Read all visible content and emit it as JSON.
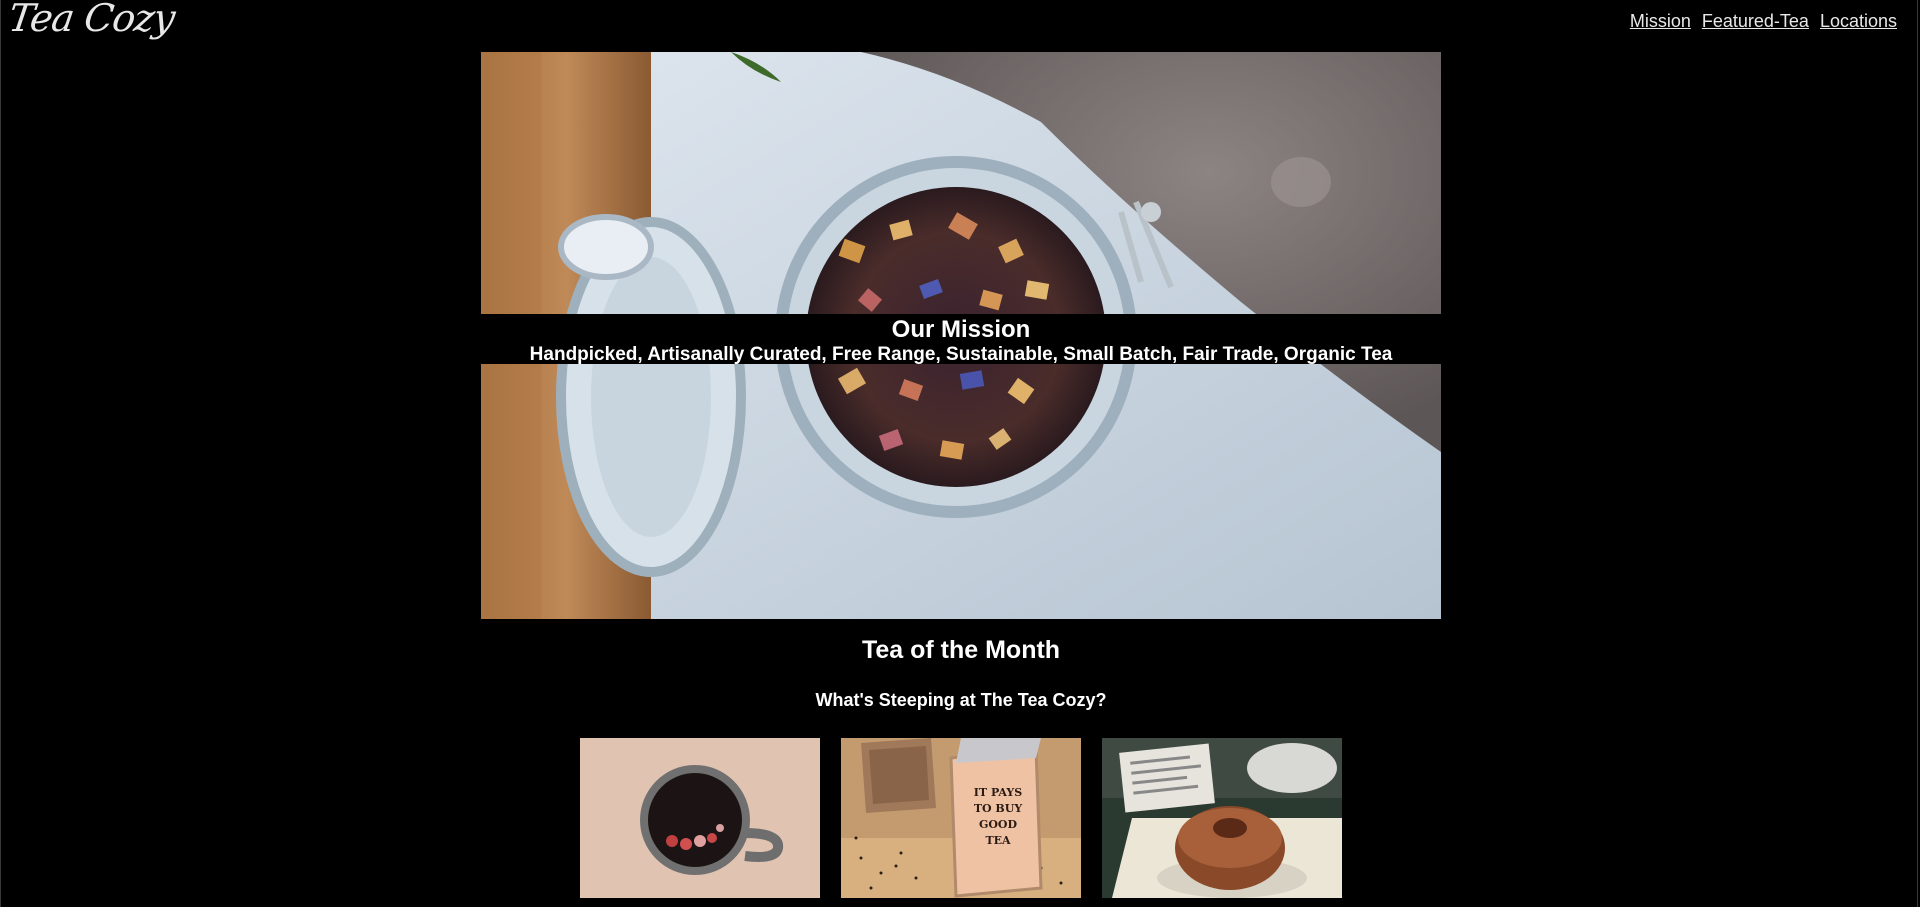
{
  "header": {
    "logo": "Tea Cozy",
    "nav": [
      {
        "label": "Mission"
      },
      {
        "label": "Featured-Tea"
      },
      {
        "label": "Locations"
      }
    ]
  },
  "hero": {
    "title": "Our Mission",
    "subtitle": "Handpicked, Artisanally Curated, Free Range, Sustainable, Small Batch, Fair Trade, Organic Tea"
  },
  "featured": {
    "title": "Tea of the Month",
    "subtitle": "What's Steeping at The Tea Cozy?",
    "images": [
      {
        "name": "berry-tea-mug-image"
      },
      {
        "name": "tea-box-image",
        "sign_lines": [
          "IT PAYS",
          "TO BUY",
          "GOOD",
          "TEA"
        ]
      },
      {
        "name": "donut-image"
      }
    ]
  }
}
